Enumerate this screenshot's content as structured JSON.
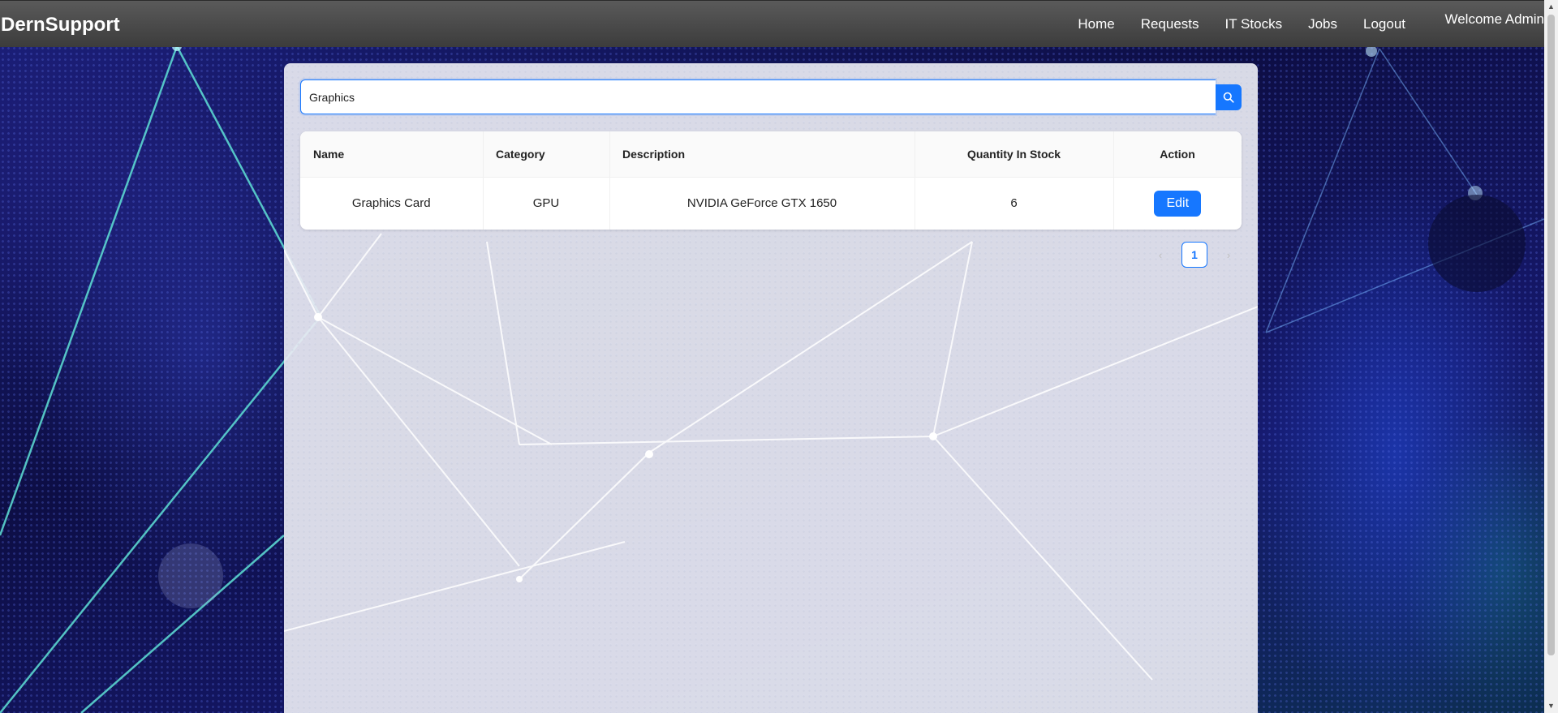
{
  "navbar": {
    "brand": "DernSupport",
    "links": [
      "Home",
      "Requests",
      "IT Stocks",
      "Jobs",
      "Logout"
    ],
    "welcome": "Welcome Admin"
  },
  "search": {
    "value": "Graphics",
    "placeholder": ""
  },
  "table": {
    "headers": [
      "Name",
      "Category",
      "Description",
      "Quantity In Stock",
      "Action"
    ],
    "rows": [
      {
        "name": "Graphics Card",
        "category": "GPU",
        "description": "NVIDIA GeForce GTX 1650",
        "quantity": "6",
        "action": "Edit"
      }
    ]
  },
  "pagination": {
    "current_page": "1"
  },
  "colors": {
    "primary": "#1677ff",
    "navbar": "#4a4a4a",
    "background": "#10124a"
  }
}
